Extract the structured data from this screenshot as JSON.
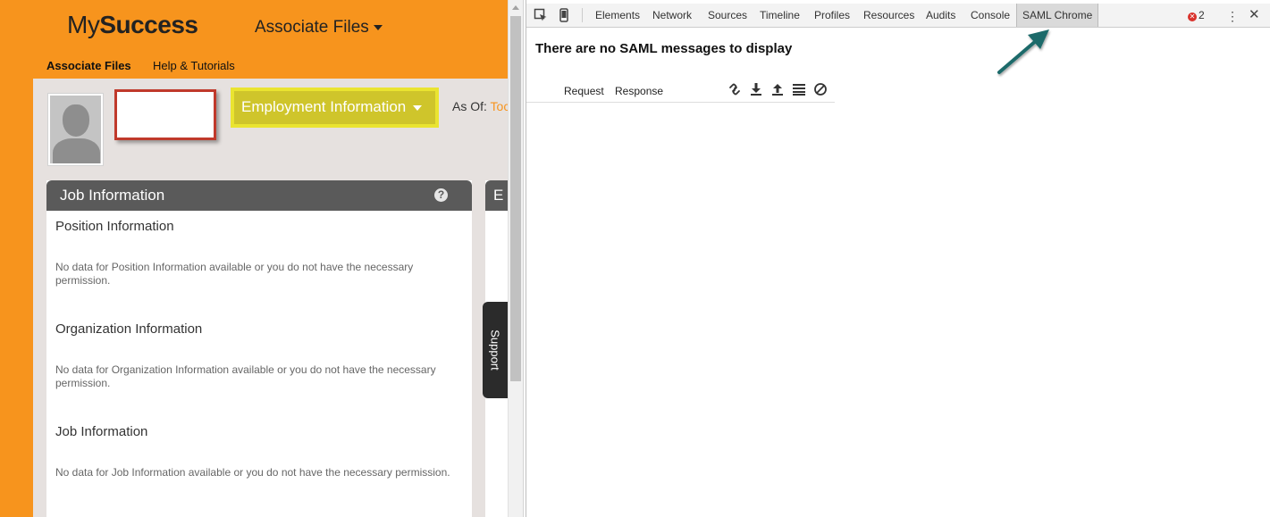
{
  "app": {
    "logo_light": "My",
    "logo_bold": "Success",
    "top_menu": "Associate Files",
    "subnav": [
      "Associate Files",
      "Help & Tutorials"
    ],
    "employment_dropdown": "Employment Information",
    "as_of_label": "As Of:",
    "as_of_value": "Toc",
    "card": {
      "title": "Job Information",
      "help": "?",
      "sections": [
        {
          "title": "Position Information",
          "text": "No data for Position Information available or you do not have the necessary permission."
        },
        {
          "title": "Organization Information",
          "text": "No data for Organization Information available or you do not have the necessary permission."
        },
        {
          "title": "Job Information",
          "text": "No data for Job Information available or you do not have the necessary permission."
        }
      ]
    },
    "card2_title": "E",
    "support_tab": "Support"
  },
  "devtools": {
    "tabs": [
      "Elements",
      "Network",
      "Sources",
      "Timeline",
      "Profiles",
      "Resources",
      "Audits",
      "Console",
      "SAML Chrome"
    ],
    "selected_tab": "SAML Chrome",
    "error_count": "2",
    "message": "There are no SAML messages to display",
    "subtabs": [
      "Request",
      "Response"
    ],
    "icons": [
      "link-icon",
      "download-icon",
      "upload-icon",
      "settings-icon",
      "clear-icon"
    ]
  },
  "colors": {
    "brand_orange": "#f7941d",
    "highlight_yellow": "#eae430",
    "header_gray": "#5a5a5a",
    "annotation_teal": "#1f6b6b",
    "error_red": "#d9312b"
  }
}
